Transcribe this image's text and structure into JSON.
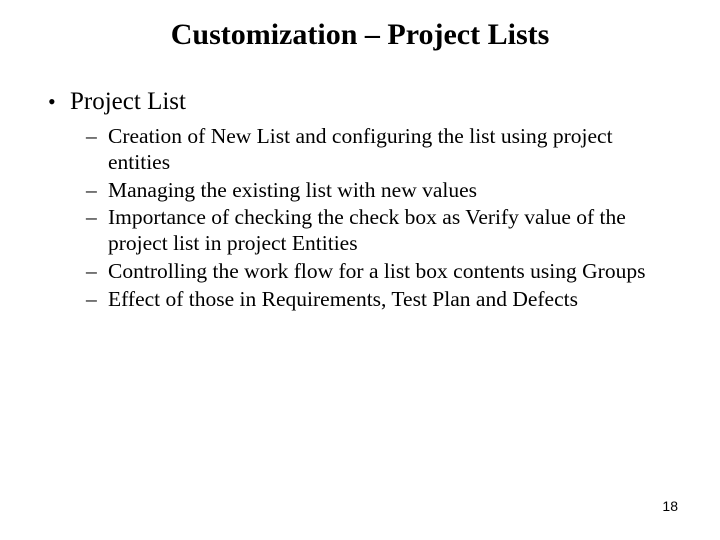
{
  "title": "Customization – Project Lists",
  "bullets": {
    "level1": {
      "item0": "Project List"
    },
    "level2": {
      "item0": "Creation of New List and configuring the list using project entities",
      "item1": "Managing the existing list with new values",
      "item2": "Importance of checking the check box as  Verify value of the project list in project Entities",
      "item3": "Controlling the work flow for a list box contents using Groups",
      "item4": "Effect of those in Requirements, Test Plan and Defects"
    }
  },
  "page_number": "18"
}
